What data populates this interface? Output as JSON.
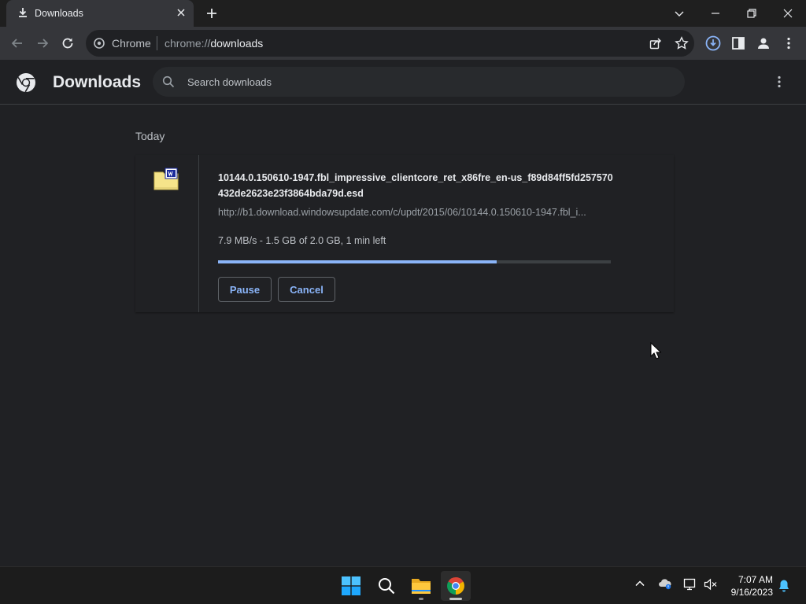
{
  "tab": {
    "title": "Downloads",
    "icon": "download-icon"
  },
  "omnibox": {
    "site_name": "Chrome",
    "url_scheme": "chrome://",
    "url_host": "downloads"
  },
  "page": {
    "title": "Downloads",
    "search_placeholder": "Search downloads"
  },
  "downloads": {
    "date_header": "Today",
    "items": [
      {
        "file_name": "10144.0.150610-1947.fbl_impressive_clientcore_ret_x86fre_en-us_f89d84ff5fd257570432de2623e23f3864bda79d.esd",
        "url": "http://b1.download.windowsupdate.com/c/updt/2015/06/10144.0.150610-1947.fbl_i...",
        "status": "7.9 MB/s - 1.5 GB of 2.0 GB, 1 min left",
        "progress_fraction": 0.71,
        "pause_label": "Pause",
        "cancel_label": "Cancel"
      }
    ]
  },
  "taskbar": {
    "apps": [
      "windows-start",
      "search",
      "file-explorer",
      "chrome"
    ],
    "clock_time": "7:07 AM",
    "clock_date": "9/16/2023"
  },
  "colors": {
    "accent": "#8ab4f8",
    "background": "#202124",
    "toolbar": "#35363a",
    "progress_track": "#3c4043",
    "folder_yellow": "#f5e48a"
  }
}
